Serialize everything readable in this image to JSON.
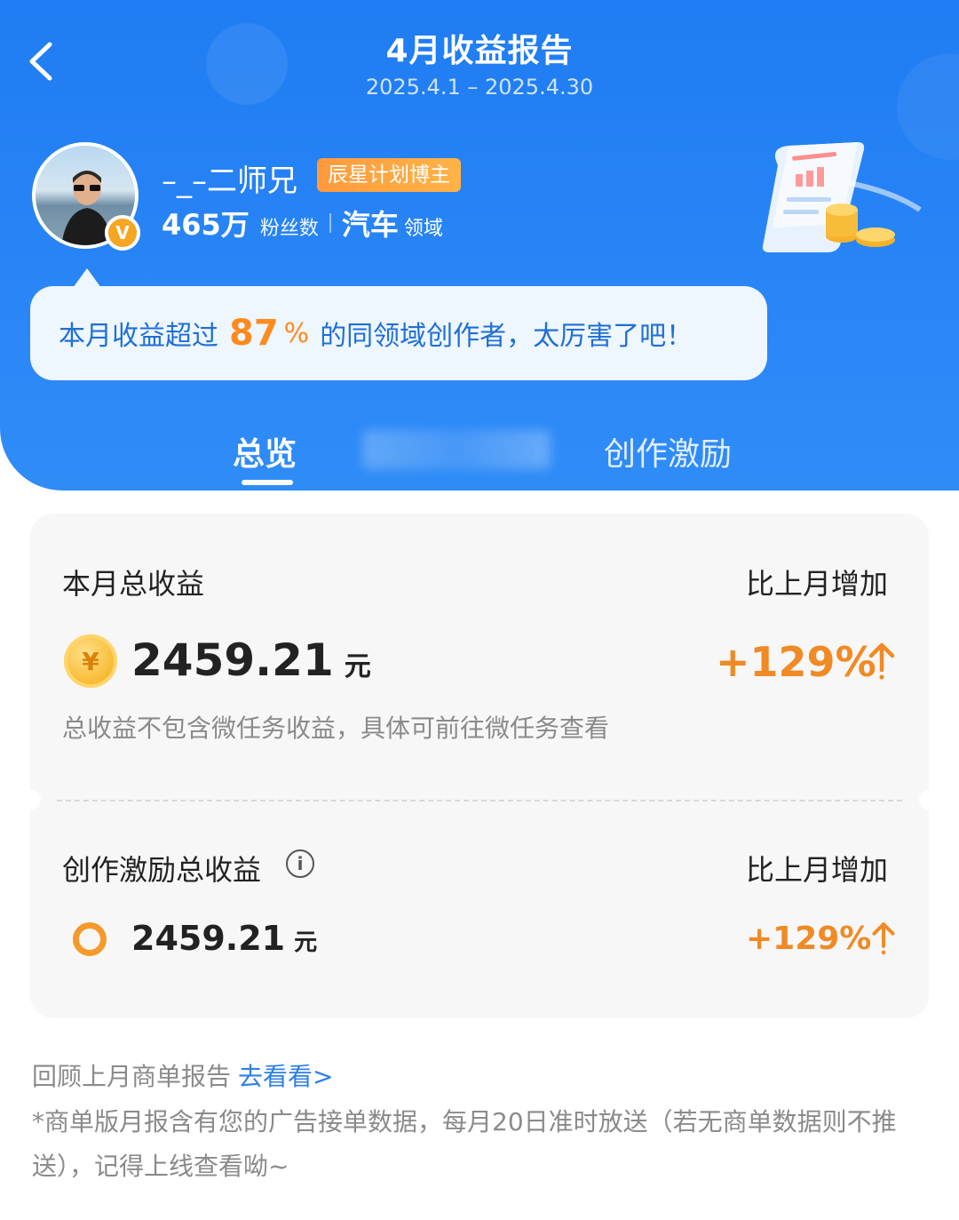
{
  "header": {
    "title": "4月收益报告",
    "date_range": "2025.4.1 – 2025.4.30"
  },
  "profile": {
    "username": "–_–二师兄",
    "plan_tag": "辰星计划博主",
    "verified_mark": "V",
    "fans_count": "465万",
    "fans_label": "粉丝数",
    "field_name": "汽车",
    "field_label": "领域"
  },
  "bubble": {
    "prefix": "本月收益超过",
    "percent": "87",
    "percent_sign": "%",
    "suffix": "的同领域创作者，太厉害了吧！"
  },
  "tabs": [
    {
      "label": "总览",
      "active": true
    },
    {
      "label": "",
      "active": false
    },
    {
      "label": "创作激励",
      "active": false
    }
  ],
  "summary": {
    "total_label": "本月总收益",
    "compare_label": "比上月增加",
    "coin_symbol": "¥",
    "total_amount": "2459.21",
    "unit": "元",
    "total_change": "+129%",
    "note": "总收益不包含微任务收益，具体可前往微任务查看"
  },
  "incentive": {
    "label": "创作激励总收益",
    "info_symbol": "i",
    "compare_label": "比上月增加",
    "amount": "2459.21",
    "unit": "元",
    "change": "+129%"
  },
  "footer": {
    "review_text": "回顾上月商单报告",
    "review_link": "去看看>",
    "note": "*商单版月报含有您的广告接单数据，每月20日准时放送（若无商单数据则不推送），记得上线查看呦~"
  },
  "colors": {
    "header_blue": "#1f7cf2",
    "accent_orange": "#f08a24",
    "link_blue": "#2f7fe6"
  }
}
